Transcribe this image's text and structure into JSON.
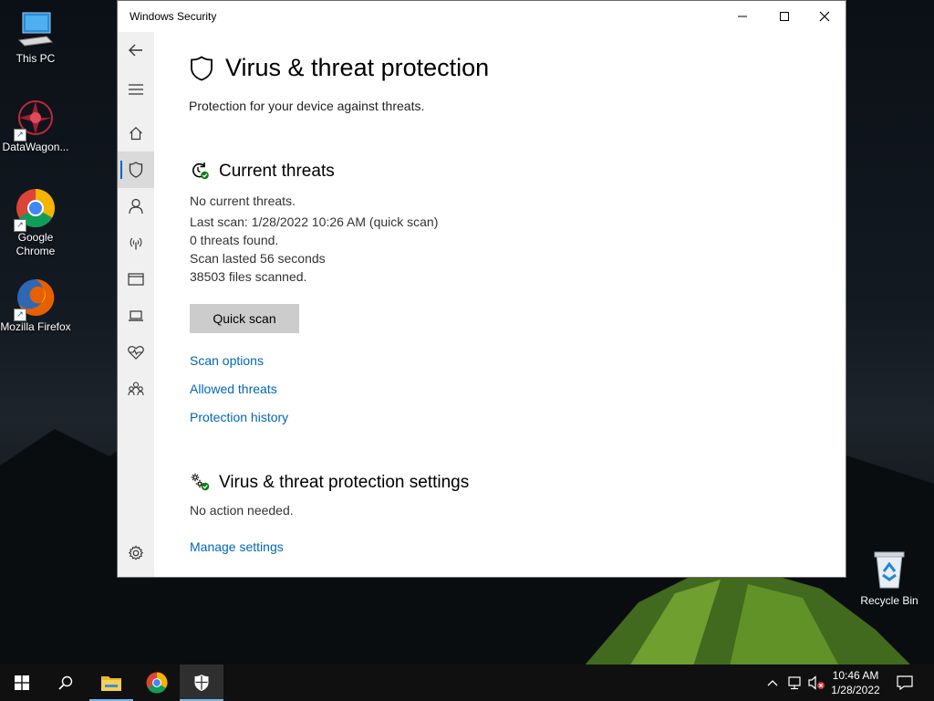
{
  "desktop": {
    "icons": [
      {
        "label": "This PC",
        "icon": "monitor-icon"
      },
      {
        "label": "DataWagon...",
        "icon": "datawagon-icon"
      },
      {
        "label": "Google Chrome",
        "icon": "chrome-icon"
      },
      {
        "label": "Mozilla Firefox",
        "icon": "firefox-icon"
      }
    ],
    "recycle_bin": {
      "label": "Recycle Bin",
      "icon": "recycle-bin-icon"
    }
  },
  "window": {
    "title": "Windows Security",
    "controls": {
      "minimize": "minimize-icon",
      "maximize": "maximize-icon",
      "close": "close-icon"
    }
  },
  "sidebar": {
    "items": [
      {
        "name": "back",
        "icon": "back-arrow-icon"
      },
      {
        "name": "menu",
        "icon": "hamburger-icon"
      },
      {
        "name": "home",
        "icon": "home-icon"
      },
      {
        "name": "virus-threat",
        "icon": "shield-icon",
        "active": true
      },
      {
        "name": "account",
        "icon": "person-icon"
      },
      {
        "name": "firewall",
        "icon": "antenna-icon"
      },
      {
        "name": "app-browser",
        "icon": "browser-window-icon"
      },
      {
        "name": "device-security",
        "icon": "laptop-icon"
      },
      {
        "name": "device-performance",
        "icon": "heart-pulse-icon"
      },
      {
        "name": "family",
        "icon": "family-icon"
      },
      {
        "name": "settings",
        "icon": "gear-icon"
      }
    ]
  },
  "main": {
    "title": "Virus & threat protection",
    "subtitle": "Protection for your device against threats.",
    "current_threats": {
      "heading": "Current threats",
      "lines": [
        "No current threats.",
        "Last scan: 1/28/2022 10:26 AM (quick scan)",
        "0 threats found.",
        "Scan lasted 56 seconds",
        "38503 files scanned."
      ],
      "quick_scan_label": "Quick scan",
      "links": [
        "Scan options",
        "Allowed threats",
        "Protection history"
      ]
    },
    "settings_section": {
      "heading": "Virus & threat protection settings",
      "status": "No action needed.",
      "link": "Manage settings"
    }
  },
  "taskbar": {
    "items": [
      "start-icon",
      "search-icon",
      "file-explorer-icon",
      "chrome-icon",
      "windows-security-icon"
    ],
    "clock": {
      "time": "10:46 AM",
      "date": "1/28/2022"
    },
    "colors": {
      "accent": "#76b9ed",
      "background": "#101010"
    }
  },
  "colors": {
    "link": "#0067b8",
    "button": "#cccccc",
    "sidebar": "#f0f0f0",
    "ok_green": "#107c10"
  }
}
